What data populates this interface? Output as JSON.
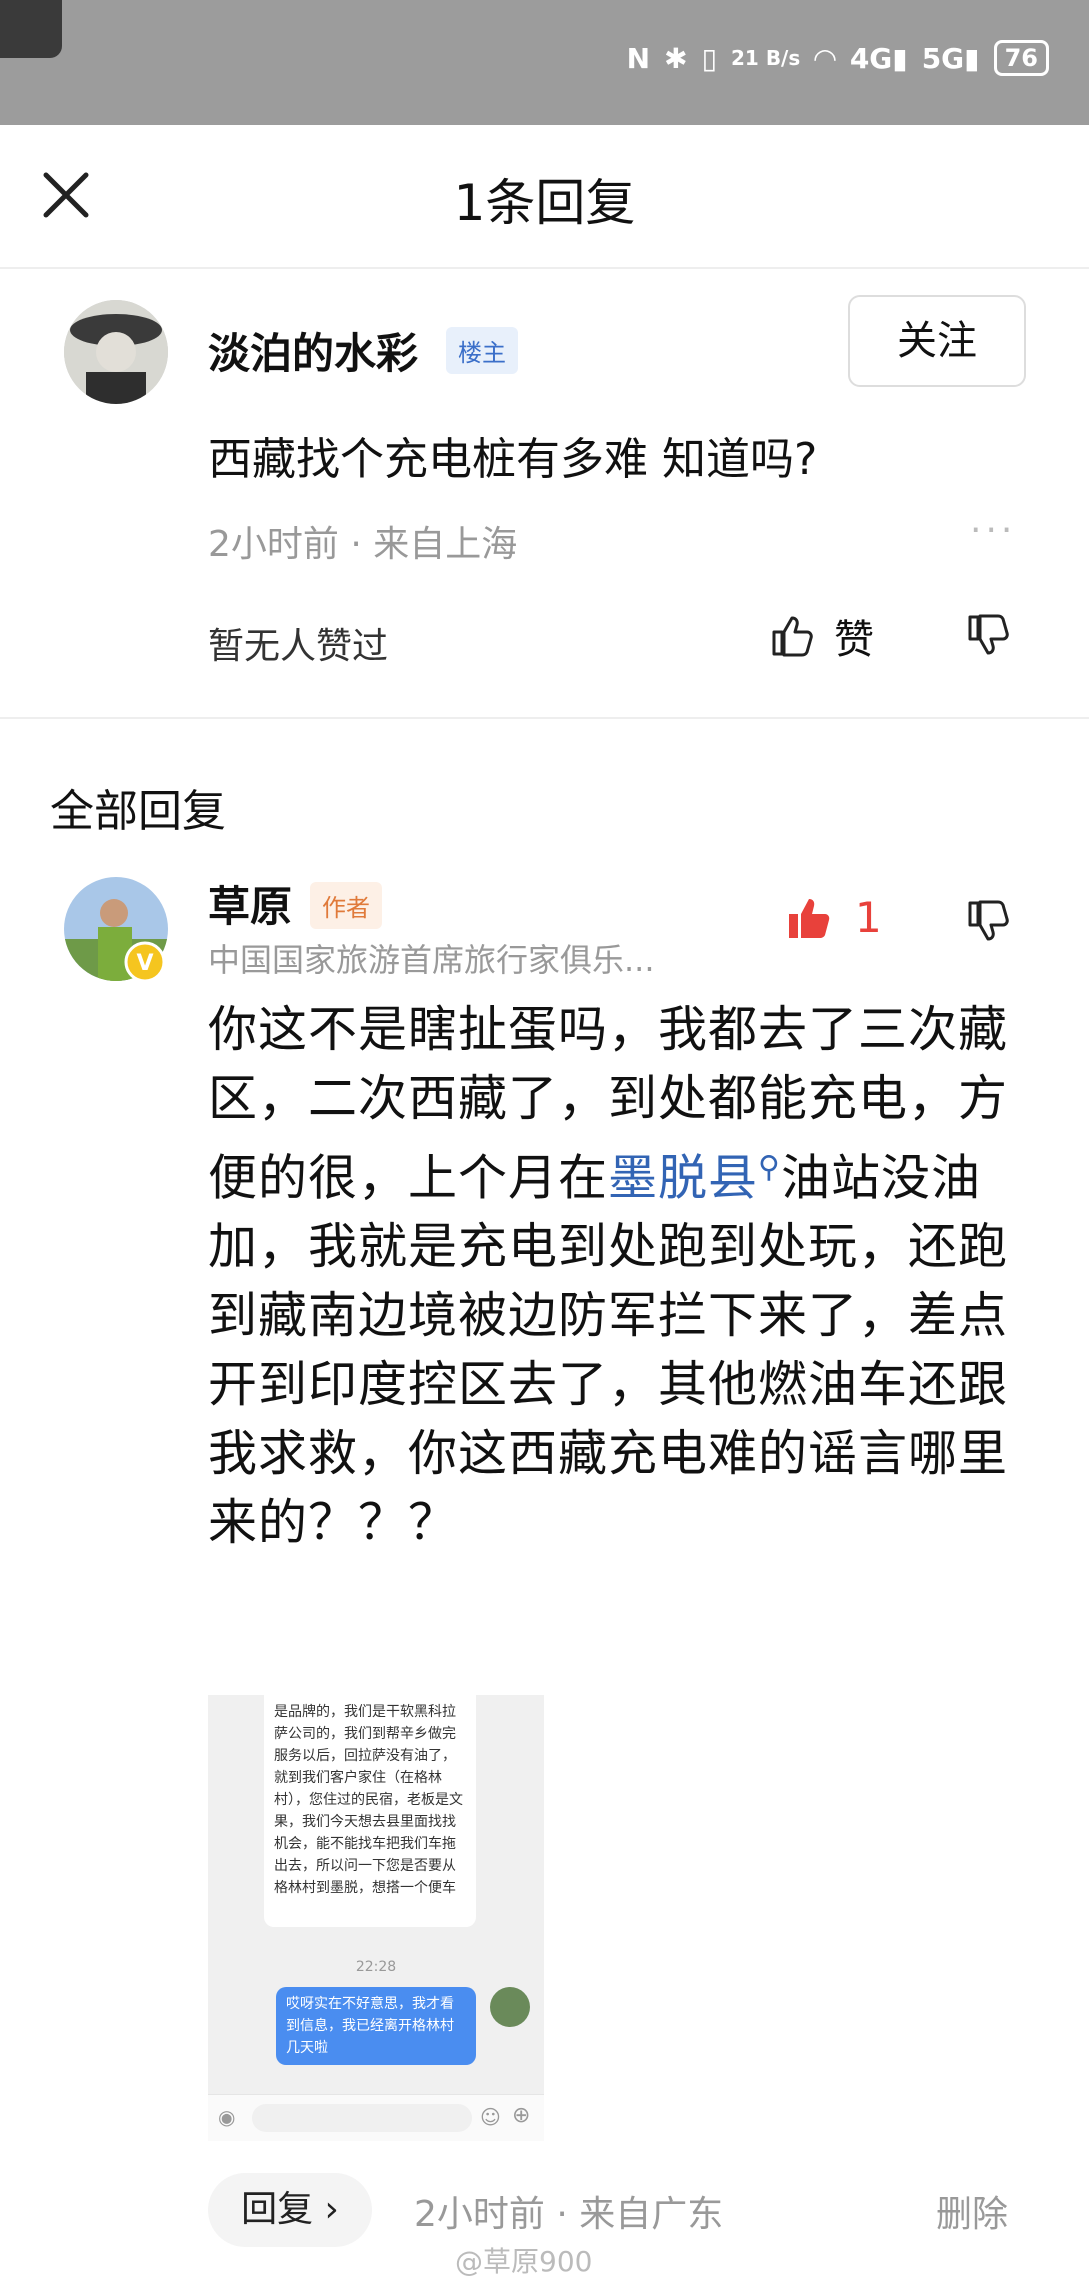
{
  "status_bar": {
    "net_speed_value": "21",
    "net_speed_unit": "B/s",
    "signal_1": "4G",
    "signal_2": "5G",
    "battery": "76"
  },
  "header": {
    "title": "1条回复"
  },
  "op": {
    "name": "淡泊的水彩",
    "badge": "楼主",
    "follow_label": "关注",
    "text": "西藏找个充电桩有多难 知道吗?",
    "meta": "2小时前 · 来自上海",
    "more": "···",
    "no_likes": "暂无人赞过",
    "like_label": "赞"
  },
  "section_title": "全部回复",
  "reply": {
    "name": "草原",
    "badge": "作者",
    "subtitle": "中国国家旅游首席旅行家俱乐...",
    "like_count": "1",
    "body_part1": "你这不是瞎扯蛋吗，我都去了三次藏区，二次西藏了，到处都能充电，方便的很，上个月在",
    "body_link": "墨脱县",
    "body_part2": "油站没油加，我就是充电到处跑到处玩，还跑到藏南边境被边防军拦下来了，差点开到印度控区去了，其他燃油车还跟我求救，你这西藏充电难的谣言哪里来的？？？",
    "image": {
      "chat_white": "是品牌的，我们是干软黑科拉萨公司的，我们到帮辛乡做完服务以后，回拉萨没有油了，就到我们客户家住（在格林村），您住过的民宿，老板是文果，我们今天想去县里面找找机会，能不能找车把我们车拖出去，所以问一下您是否要从格林村到墨脱，想搭一个便车",
      "chat_time": "22:28",
      "chat_blue": "哎呀实在不好意思，我才看到信息，我已经离开格林村几天啦"
    },
    "reply_label": "回复 ›",
    "meta": "2小时前 · 来自广东",
    "delete_label": "删除"
  },
  "watermark": "@草原900"
}
